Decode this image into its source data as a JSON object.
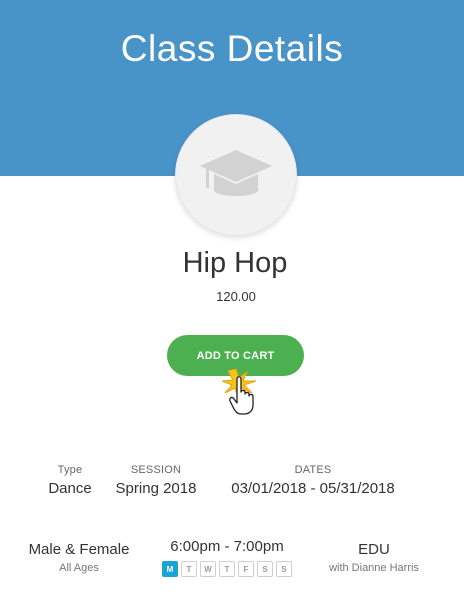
{
  "header": {
    "title": "Class Details",
    "color": "#4894c8"
  },
  "class": {
    "icon": "graduation-cap-icon",
    "name": "Hip Hop",
    "price": "120.00"
  },
  "cart_button": {
    "label": "ADD TO CART",
    "color": "#4caf50"
  },
  "details_row1": {
    "type_label": "Type",
    "type_value": "Dance",
    "session_label": "SESSION",
    "session_value": "Spring 2018",
    "dates_label": "DATES",
    "dates_value": "03/01/2018 - 05/31/2018"
  },
  "details_row2": {
    "gender": "Male & Female",
    "ages": "All Ages",
    "time": "6:00pm - 7:00pm",
    "days": [
      "M",
      "T",
      "W",
      "T",
      "F",
      "S",
      "S"
    ],
    "active_day": "M",
    "location": "EDU",
    "instructor": "with Dianne Harris"
  },
  "accent_color": "#1aa3d6"
}
